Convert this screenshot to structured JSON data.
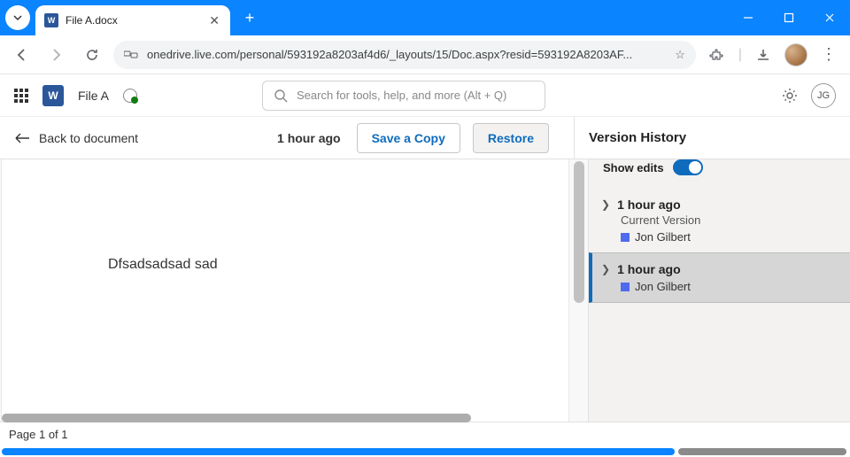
{
  "browser": {
    "tab_title": "File A.docx",
    "url": "onedrive.live.com/personal/593192a8203af4d6/_layouts/15/Doc.aspx?resid=593192A8203AF..."
  },
  "app": {
    "filename": "File A",
    "search_placeholder": "Search for tools, help, and more (Alt + Q)",
    "profile_initials": "JG"
  },
  "toolbar": {
    "back_label": "Back to document",
    "timestamp": "1 hour ago",
    "save_copy_label": "Save a Copy",
    "restore_label": "Restore"
  },
  "document": {
    "content": "Dfsadsadsad sad"
  },
  "side": {
    "title": "Version History",
    "show_edits_label": "Show edits",
    "show_edits_on": true,
    "versions": [
      {
        "time": "1 hour ago",
        "subtitle": "Current Version",
        "author": "Jon Gilbert",
        "selected": false
      },
      {
        "time": "1 hour ago",
        "subtitle": "",
        "author": "Jon Gilbert",
        "selected": true
      }
    ]
  },
  "status": {
    "page_label": "Page 1 of 1"
  }
}
